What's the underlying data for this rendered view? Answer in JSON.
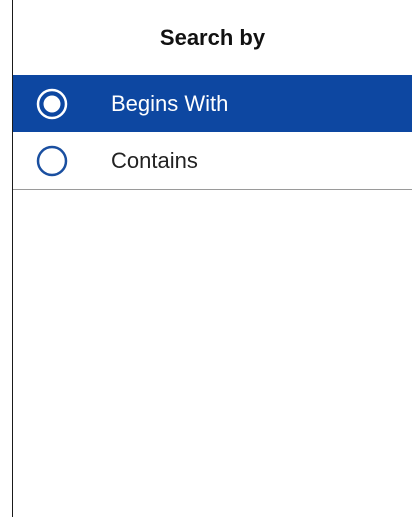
{
  "dialog": {
    "title": "Search by",
    "options": [
      {
        "label": "Begins With",
        "selected": true
      },
      {
        "label": "Contains",
        "selected": false
      }
    ]
  },
  "colors": {
    "selected_background": "#0d47a1",
    "selected_text": "#ffffff",
    "radio_unselected": "#1a4fa0",
    "divider": "#9a9a9a"
  },
  "icons": {
    "radio_selected": "radio-checked-icon",
    "radio_unselected": "radio-unchecked-icon"
  }
}
